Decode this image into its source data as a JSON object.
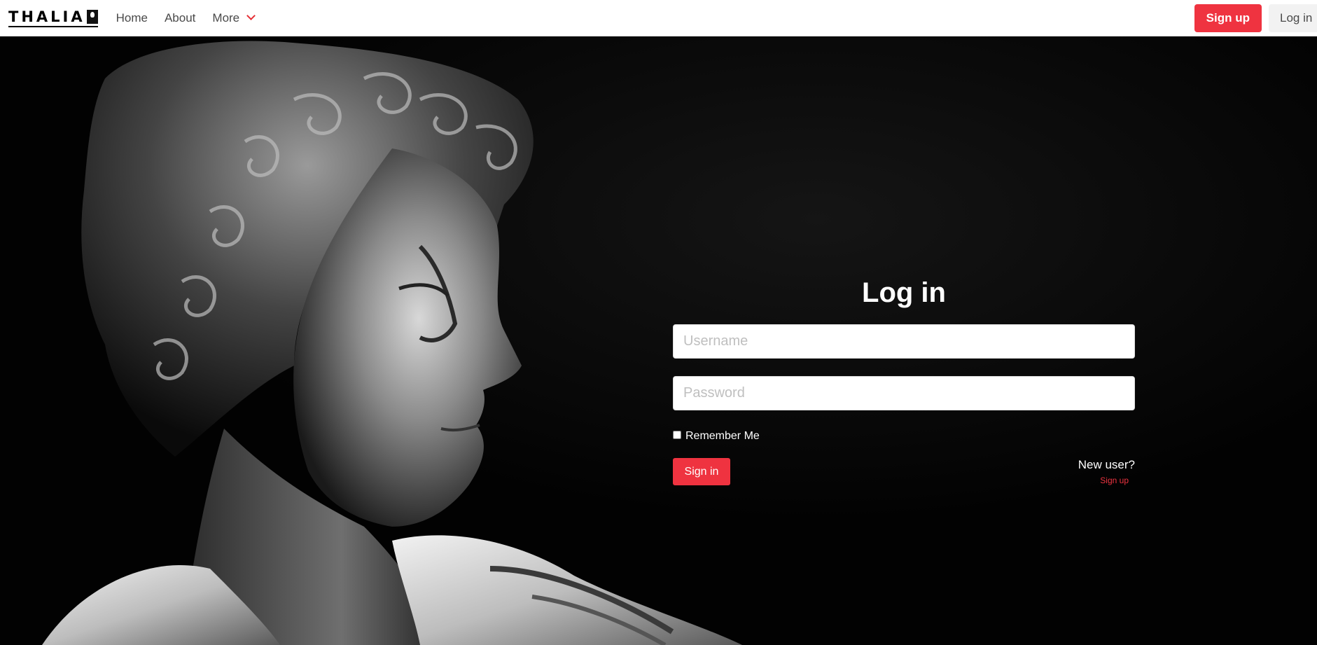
{
  "nav": {
    "logo_text": "THALIA",
    "links": [
      "Home",
      "About",
      "More"
    ],
    "signup_label": "Sign up",
    "login_label": "Log in",
    "accent_color": "#ef3340"
  },
  "login": {
    "title": "Log in",
    "username_placeholder": "Username",
    "password_placeholder": "Password",
    "remember_label": "Remember Me",
    "signin_label": "Sign in",
    "new_user_label": "New user?",
    "signup_link": "Sign up"
  },
  "icons": {
    "more": "chevron-down-icon",
    "remember": "checkbox"
  }
}
